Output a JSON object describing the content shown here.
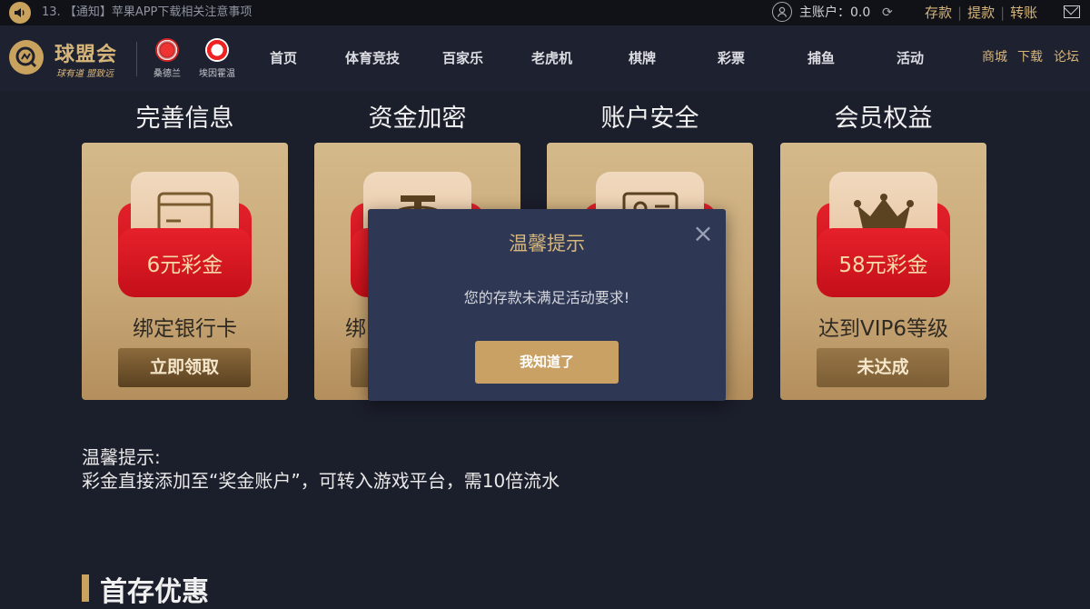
{
  "topbar": {
    "notice_index": "13.",
    "notice_text": "【通知】苹果APP下载相关注意事项",
    "account_label": "主账户：",
    "balance": "0.0",
    "links": [
      "存款",
      "提款",
      "转账"
    ]
  },
  "header": {
    "logo_title": "球盟会",
    "logo_slogan": "球有道 盟致远",
    "partners": [
      "桑德兰",
      "埃因霍温"
    ],
    "nav": [
      "首页",
      "体育竞技",
      "百家乐",
      "老虎机",
      "棋牌",
      "彩票",
      "捕鱼",
      "活动"
    ],
    "right_links": [
      "商城",
      "下载",
      "论坛"
    ]
  },
  "cards": [
    {
      "title": "完善信息",
      "icon": "bank-card-icon",
      "reward": "6元彩金",
      "desc": "绑定银行卡",
      "action": "立即领取",
      "action_state": "claimable"
    },
    {
      "title": "资金加密",
      "icon": "tether-icon",
      "reward": "",
      "desc": "绑",
      "action": "",
      "action_state": "locked"
    },
    {
      "title": "账户安全",
      "icon": "id-card-icon",
      "reward": "",
      "desc": "",
      "action": "",
      "action_state": "locked"
    },
    {
      "title": "会员权益",
      "icon": "crown-icon",
      "reward": "58元彩金",
      "desc": "达到VIP6等级",
      "action": "未达成",
      "action_state": "locked"
    }
  ],
  "tips": {
    "heading": "温馨提示:",
    "body": "彩金直接添加至“奖金账户”，可转入游戏平台，需10倍流水"
  },
  "section_title": "首存优惠",
  "modal": {
    "title": "温馨提示",
    "message": "您的存款未满足活动要求!",
    "confirm_label": "我知道了"
  },
  "colors": {
    "gold": "#d6b57a",
    "red_envelope": "#d81a24",
    "modal_bg": "#2e3754",
    "page_bg": "#1b1e2b"
  }
}
